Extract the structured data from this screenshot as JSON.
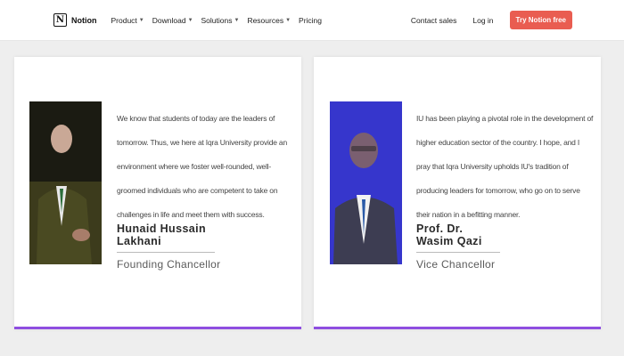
{
  "nav": {
    "brand": "Notion",
    "logo_glyph": "N",
    "items": [
      "Product",
      "Download",
      "Solutions",
      "Resources",
      "Pricing"
    ],
    "contact_sales": "Contact sales",
    "login": "Log in",
    "cta": "Try Notion free"
  },
  "cards": [
    {
      "quote": "We know that students of today are the leaders of tomorrow. Thus, we here at Iqra University provide an environment where we foster well-rounded, well-groomed individuals who are competent to take on challenges in life and meet them with success.",
      "name": "Hunaid Hussain Lakhani",
      "title": "Founding Chancellor"
    },
    {
      "quote": "IU has been playing a pivotal role in the development of higher education sector of the country. I hope, and I pray that Iqra University upholds IU's tradition of producing leaders for tomorrow, who go on to serve their nation in a befitting manner.",
      "name": "Prof. Dr. Wasim Qazi",
      "title": "Vice Chancellor"
    }
  ],
  "colors": {
    "cta": "#e95d51",
    "card_accent": "#8e4ee0",
    "background": "#eeeeee"
  }
}
